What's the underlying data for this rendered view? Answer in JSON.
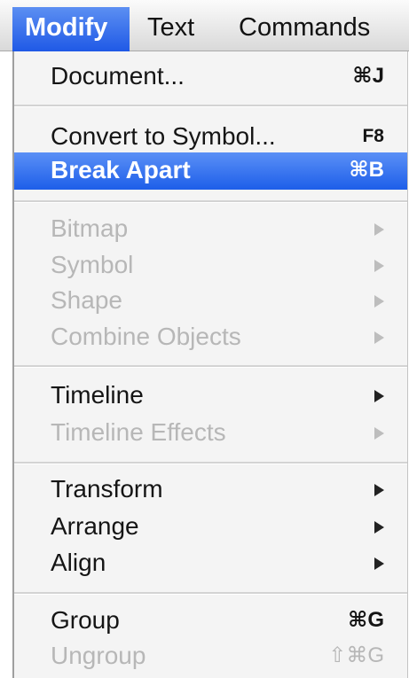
{
  "menubar": {
    "items": [
      {
        "label": "Modify",
        "active": true
      },
      {
        "label": "Text",
        "active": false
      },
      {
        "label": "Commands",
        "active": false
      }
    ]
  },
  "menu": {
    "items": [
      {
        "label": "Document...",
        "shortcut": "⌘J",
        "enabled": true,
        "submenu": false
      },
      {
        "label": "Convert to Symbol...",
        "shortcut": "F8",
        "enabled": true,
        "submenu": false
      },
      {
        "label": "Break Apart",
        "shortcut": "⌘B",
        "enabled": true,
        "submenu": false,
        "highlighted": true
      },
      {
        "label": "Bitmap",
        "enabled": false,
        "submenu": true
      },
      {
        "label": "Symbol",
        "enabled": false,
        "submenu": true
      },
      {
        "label": "Shape",
        "enabled": false,
        "submenu": true
      },
      {
        "label": "Combine Objects",
        "enabled": false,
        "submenu": true
      },
      {
        "label": "Timeline",
        "enabled": true,
        "submenu": true
      },
      {
        "label": "Timeline Effects",
        "enabled": false,
        "submenu": true
      },
      {
        "label": "Transform",
        "enabled": true,
        "submenu": true
      },
      {
        "label": "Arrange",
        "enabled": true,
        "submenu": true
      },
      {
        "label": "Align",
        "enabled": true,
        "submenu": true
      },
      {
        "label": "Group",
        "shortcut": "⌘G",
        "enabled": true,
        "submenu": false
      },
      {
        "label": "Ungroup",
        "shortcut": "⇧⌘G",
        "enabled": false,
        "submenu": false
      }
    ]
  },
  "colors": {
    "highlight": "#1d5ee9",
    "disabled_text": "#b7b7b7",
    "menu_background": "#f4f4f4"
  },
  "icons": {
    "submenu_arrow": "chevron-right-icon"
  }
}
